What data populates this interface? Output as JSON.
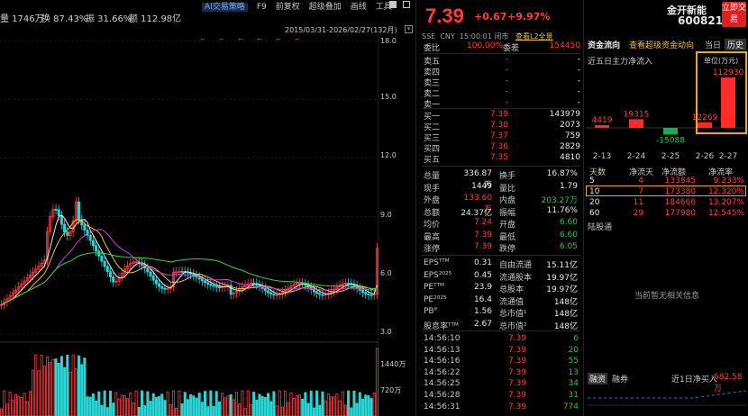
{
  "top_stats": {
    "volume": "量 1746万",
    "turnover": "换 87.43%",
    "amplitude": "振 31.66%",
    "amount": "额 112.98亿"
  },
  "toolbar": {
    "items": [
      "AI交易策略",
      "F9",
      "前复权",
      "超级叠加",
      "画线",
      "工具"
    ],
    "active": "AI交易策略"
  },
  "chart": {
    "date_range": "2015/03/31-2026/02/27(132月)",
    "price_ticks": [
      "18.0",
      "15.0",
      "12.0",
      "9.0",
      "6.0",
      "3.0"
    ],
    "volume_ticks": [
      "1440万",
      "720万"
    ]
  },
  "chart_data": {
    "type": "candlestick",
    "title": "",
    "ylim": [
      3.0,
      18.0
    ],
    "price_axis": [
      18.0,
      15.0,
      12.0,
      9.0,
      6.0,
      3.0
    ],
    "volume_axis_labels": [
      "1440万",
      "720万"
    ],
    "last_close": 7.39
  },
  "quote": {
    "price": "7.39",
    "change": "+0.67",
    "change_pct": "+9.97%",
    "exchange": "SSE",
    "currency": "CNY",
    "time": "15:00:01",
    "status": "闭市",
    "l2_link": "查看L2全景",
    "weibi_label": "委比",
    "weibi_value": "100.00%",
    "weicha_label": "委差",
    "weicha_value": "154450",
    "sell": [
      {
        "label": "卖五",
        "price": "-",
        "vol": "-"
      },
      {
        "label": "卖四",
        "price": "-",
        "vol": "-"
      },
      {
        "label": "卖三",
        "price": "-",
        "vol": "-"
      },
      {
        "label": "卖二",
        "price": "-",
        "vol": "-"
      },
      {
        "label": "卖一",
        "price": "-",
        "vol": "-"
      }
    ],
    "buy": [
      {
        "label": "买一",
        "price": "7.39",
        "vol": "143979"
      },
      {
        "label": "买二",
        "price": "7.38",
        "vol": "2073"
      },
      {
        "label": "买三",
        "price": "7.37",
        "vol": "759"
      },
      {
        "label": "买四",
        "price": "7.36",
        "vol": "2829"
      },
      {
        "label": "买五",
        "price": "7.35",
        "vol": "4810"
      }
    ],
    "stats": [
      {
        "a": "总量",
        "av": "336.87万",
        "ac": "white",
        "b": "换手",
        "bv": "16.87%",
        "bc": "white"
      },
      {
        "a": "现手",
        "av": "1449",
        "ac": "white",
        "b": "量比",
        "bv": "1.79",
        "bc": "white"
      },
      {
        "a": "外盘",
        "av": "133.60万",
        "ac": "red",
        "b": "内盘",
        "bv": "203.27万",
        "bc": "green"
      },
      {
        "a": "总额",
        "av": "24.37亿",
        "ac": "white",
        "b": "振幅",
        "bv": "11.76%",
        "bc": "white"
      },
      {
        "a": "均价",
        "av": "7.24",
        "ac": "red",
        "b": "开盘",
        "bv": "6.60",
        "bc": "green"
      },
      {
        "a": "最高",
        "av": "7.39",
        "ac": "red",
        "b": "最低",
        "bv": "6.60",
        "bc": "green"
      },
      {
        "a": "涨停",
        "av": "7.39",
        "ac": "red",
        "b": "跌停",
        "bv": "6.05",
        "bc": "green"
      }
    ],
    "fundamentals": [
      {
        "a": "EPSᵀᵀᴹ",
        "av": "0.31",
        "b": "自由流通",
        "bv": "15.11亿"
      },
      {
        "a": "EPS²⁰²⁵",
        "av": "0.45",
        "b": "流通股本",
        "bv": "19.97亿"
      },
      {
        "a": "PEᵀᵀᴹ",
        "av": "23.9",
        "b": "总股本",
        "bv": "19.97亿"
      },
      {
        "a": "PE²⁰²⁵",
        "av": "16.4",
        "b": "流通值",
        "bv": "148亿"
      },
      {
        "a": "PBˡᶠ",
        "av": "1.56",
        "b": "总市值¹",
        "bv": "148亿"
      },
      {
        "a": "股息率ᵀᵀᴹ",
        "av": "2.67",
        "b": "总市值²",
        "bv": "148亿"
      }
    ],
    "ticks": [
      {
        "t": "14:56:10",
        "p": "7.39",
        "v": "6"
      },
      {
        "t": "14:56:13",
        "p": "7.39",
        "v": "20"
      },
      {
        "t": "14:56:16",
        "p": "7.39",
        "v": "55"
      },
      {
        "t": "14:56:22",
        "p": "7.39",
        "v": "13"
      },
      {
        "t": "14:56:25",
        "p": "7.39",
        "v": "34"
      },
      {
        "t": "14:56:28",
        "p": "7.39",
        "v": "31"
      },
      {
        "t": "14:56:31",
        "p": "7.39",
        "v": "774"
      }
    ]
  },
  "right": {
    "name": "金开新能",
    "code": "600821",
    "buy_button": "立即交易",
    "tabs": {
      "t1": "资金流向",
      "t2": "查看超级资金动向",
      "t3": "当日",
      "t4": "历史"
    },
    "flow_title": "近五日主力净流入",
    "unit": "单位(万元)",
    "flow_values": [
      {
        "date": "2-13",
        "value": 4419
      },
      {
        "date": "2-24",
        "value": 19315
      },
      {
        "date": "2-25",
        "value": -15088
      },
      {
        "date": "2-26",
        "value": 12269
      },
      {
        "date": "2-27",
        "value": 112930
      }
    ],
    "flow_labels": [
      "4419",
      "19315",
      "-15088",
      "12269",
      "112930"
    ],
    "flow_dates": [
      "2-13",
      "2-24",
      "2-25",
      "2-26",
      "2-27"
    ],
    "table_header": [
      "天数",
      "净流天",
      "净流额",
      "净流率"
    ],
    "table_rows": [
      [
        "5",
        "4",
        "133845",
        "9.233%"
      ],
      [
        "10",
        "7",
        "173380",
        "12.320%"
      ],
      [
        "20",
        "11",
        "184666",
        "13.207%"
      ],
      [
        "60",
        "29",
        "177980",
        "12.545%"
      ]
    ],
    "hsgt_title": "陆股通",
    "no_data": "当前暂无相关信息",
    "bottom_tabs": [
      "融资",
      "融券"
    ],
    "net_buy_label": "近1日净买入",
    "net_buy_value": "682.58万"
  }
}
